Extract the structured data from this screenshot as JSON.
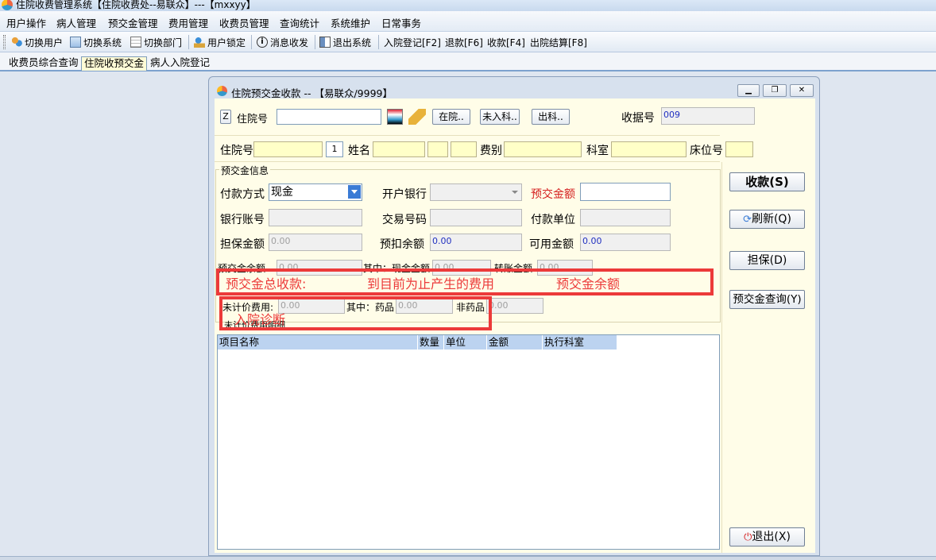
{
  "app": {
    "title": "住院收费管理系统【住院收费处--易联众】---【mxxyy】"
  },
  "menu": [
    "用户操作",
    "病人管理",
    "预交金管理",
    "费用管理",
    "收费员管理",
    "查询统计",
    "系统维护",
    "日常事务"
  ],
  "toolbar": {
    "switch_user": "切换用户",
    "switch_system": "切换系统",
    "switch_dept": "切换部门",
    "lock_user": "用户锁定",
    "messages": "消息收发",
    "exit_system": "退出系统",
    "admission": "入院登记[F2]",
    "refund": "退款[F6]",
    "charge": "收款[F4]",
    "discharge": "出院结算[F8]"
  },
  "tabs": [
    "收费员综合查询",
    "住院收预交金",
    "病人入院登记"
  ],
  "window": {
    "title": "住院预交金收款 -- 【易联众/9999】"
  },
  "header": {
    "z_label": "Z",
    "inpatient_no_label": "住院号",
    "inpatient_no_value": "",
    "btn_in_hospital": "在院..",
    "btn_not_admitted": "未入科..",
    "btn_discharged": "出科..",
    "receipt_no_label": "收据号",
    "receipt_no_value": "009"
  },
  "patient": {
    "inpatient_no_label": "住院号",
    "seq_value": "1",
    "name_label": "姓名",
    "fee_type_label": "费别",
    "dept_label": "科室",
    "bed_label": "床位号"
  },
  "prepay": {
    "group_title": "预交金信息",
    "pay_method_label": "付款方式",
    "pay_method_value": "现金",
    "bank_label": "开户银行",
    "amount_label": "预交金额",
    "amount_value": "",
    "account_label": "银行账号",
    "trans_no_label": "交易号码",
    "payer_unit_label": "付款单位",
    "guarantee_label": "担保金额",
    "guarantee_value": "0.00",
    "withhold_label": "预扣余额",
    "withhold_value": "0.00",
    "available_label": "可用金额",
    "available_value": "0.00",
    "total_label": "预交金余额",
    "total_value": "0.00",
    "cash_label": "其中：现金金额",
    "cash_value": "0.00",
    "transfer_label": "转账金额",
    "transfer_value": "0.00"
  },
  "unbilled": {
    "fee_label": "未计价费用:",
    "fee_value": "0.00",
    "drug_label": "其中：药品",
    "drug_value": "0.00",
    "nondrug_label": "非药品",
    "nondrug_value": "0.00",
    "detail_title": "未计价费用明细"
  },
  "annotations": {
    "line1": [
      "预交金总收款:",
      "到目前为止产生的费用",
      "预交金余额"
    ],
    "line2": "入院诊断",
    "color": "#ec3a3a"
  },
  "grid": {
    "columns": [
      "项目名称",
      "数量",
      "单位",
      "金额",
      "执行科室"
    ]
  },
  "actions": {
    "collect": "收款(S)",
    "refresh": "刷新(Q)",
    "guarantee": "担保(D)",
    "query": "预交金查询(Y)",
    "exit": "退出(X)"
  }
}
